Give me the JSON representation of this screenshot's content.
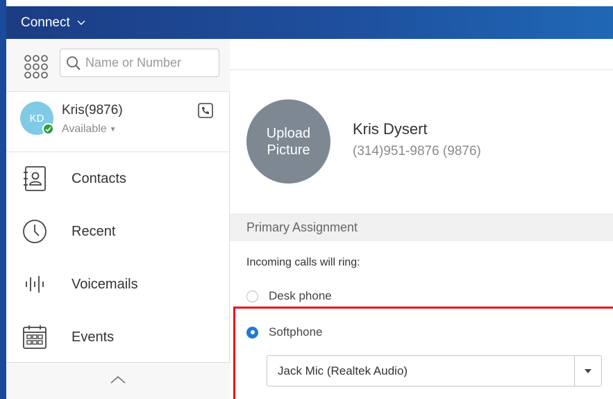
{
  "titlebar": {
    "title": "Connect"
  },
  "sidebar": {
    "search": {
      "placeholder": "Name or Number"
    },
    "user": {
      "initials": "KD",
      "name": "Kris(9876)",
      "status": "Available"
    },
    "nav": [
      {
        "label": "Contacts",
        "icon": "contacts-icon"
      },
      {
        "label": "Recent",
        "icon": "clock-icon"
      },
      {
        "label": "Voicemails",
        "icon": "voicemail-icon"
      },
      {
        "label": "Events",
        "icon": "calendar-icon"
      }
    ]
  },
  "profile": {
    "upload_label": "Upload\nPicture",
    "name": "Kris Dysert",
    "number": "(314)951-9876 (9876)"
  },
  "assignment": {
    "section_title": "Primary Assignment",
    "ring_label": "Incoming calls will ring:",
    "options": [
      {
        "label": "Desk phone",
        "checked": false
      },
      {
        "label": "Softphone",
        "checked": true
      }
    ],
    "audio_device": "Jack Mic (Realtek Audio)"
  },
  "colors": {
    "accent": "#1f7ad6",
    "titlebar": "#1e4f9d",
    "highlight": "#e8141b",
    "presence": "#2e9d3f"
  }
}
